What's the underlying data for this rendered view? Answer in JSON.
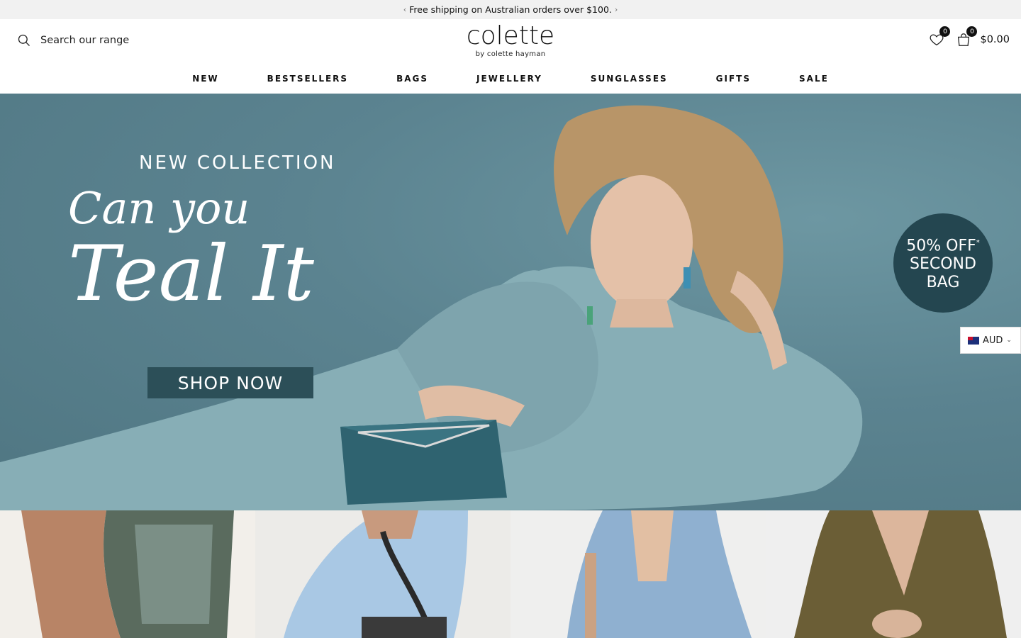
{
  "announcement": {
    "text": "Free shipping on Australian orders over $100.",
    "prev_icon": "chevron-left-icon",
    "next_icon": "chevron-right-icon"
  },
  "header": {
    "search_placeholder": "Search our range",
    "logo_name": "colette",
    "logo_sub": "by colette hayman",
    "wishlist_count": "0",
    "cart_count": "0",
    "cart_total": "$0.00"
  },
  "nav": {
    "items": [
      "NEW",
      "BESTSELLERS",
      "BAGS",
      "JEWELLERY",
      "SUNGLASSES",
      "GIFTS",
      "SALE"
    ]
  },
  "hero": {
    "eyebrow": "NEW COLLECTION",
    "script_line1": "Can you",
    "script_line2": "Teal It",
    "cta": "SHOP NOW",
    "offer_line1": "50% OFF",
    "offer_star": "*",
    "offer_line2": "SECOND",
    "offer_line3": "BAG",
    "bg_color": "#5e8590",
    "cta_color": "#2c4f58"
  },
  "currency": {
    "code": "AUD",
    "flag_icon": "australia-flag-icon"
  },
  "colors": {
    "announcement_bg": "#f1f1f1",
    "text": "#111111",
    "offer_badge": "#244650"
  }
}
